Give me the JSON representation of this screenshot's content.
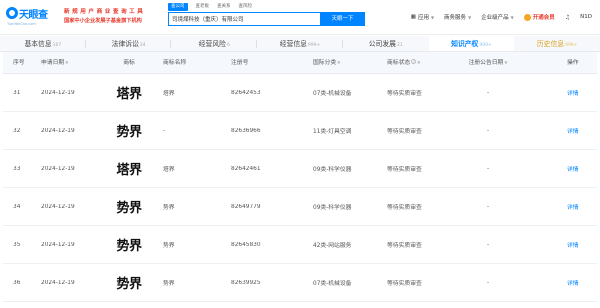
{
  "header": {
    "logo_text": "天眼查",
    "logo_sub": "TianYanCha.com",
    "promo_line1": "新 规 用 户 商 业 查 询 工 具",
    "promo_line2": "国家中小企业发展子基金旗下机构",
    "search_tabs": [
      "查公司",
      "查老板",
      "查关系",
      "查风险"
    ],
    "search_value": "司境煤科技（重庆）有限公司",
    "search_button": "天眼一下",
    "nav": {
      "app": "应用",
      "business_services": "商务服务",
      "enterprise_products": "企业级产品",
      "vip": "开通会员",
      "user": "N1D"
    }
  },
  "tabs": [
    {
      "label": "基本信息",
      "count": "167"
    },
    {
      "label": "法律诉讼",
      "count": "34"
    },
    {
      "label": "经营风险",
      "count": "6"
    },
    {
      "label": "经营信息",
      "count": "999+"
    },
    {
      "label": "公司发展",
      "count": "21"
    },
    {
      "label": "知识产权",
      "count": "999+"
    },
    {
      "label": "历史信息",
      "count": "999+"
    }
  ],
  "table": {
    "columns": [
      "序号",
      "申请日期",
      "商标",
      "商标名称",
      "注册号",
      "国际分类",
      "商标状态",
      "注册公告日期",
      "操作"
    ],
    "rows": [
      {
        "index": "31",
        "date": "2024-12-19",
        "mark": "塔界",
        "name": "塔界",
        "reg_no": "82642453",
        "class": "07类-机械设备",
        "status": "等待实质审查",
        "pub_date": "-",
        "op": "详情"
      },
      {
        "index": "32",
        "date": "2024-12-19",
        "mark": "势界",
        "name": "-",
        "reg_no": "82636966",
        "class": "11类-灯具空调",
        "status": "等待实质审查",
        "pub_date": "-",
        "op": "详情"
      },
      {
        "index": "33",
        "date": "2024-12-19",
        "mark": "塔界",
        "name": "塔界",
        "reg_no": "82642461",
        "class": "09类-科学仪器",
        "status": "等待实质审查",
        "pub_date": "-",
        "op": "详情"
      },
      {
        "index": "34",
        "date": "2024-12-19",
        "mark": "势界",
        "name": "势界",
        "reg_no": "82649779",
        "class": "09类-科学仪器",
        "status": "等待实质审查",
        "pub_date": "-",
        "op": "详情"
      },
      {
        "index": "35",
        "date": "2024-12-19",
        "mark": "势界",
        "name": "势界",
        "reg_no": "82645830",
        "class": "42类-网站服务",
        "status": "等待实质审查",
        "pub_date": "-",
        "op": "详情"
      },
      {
        "index": "36",
        "date": "2024-12-19",
        "mark": "势界",
        "name": "势界",
        "reg_no": "82639925",
        "class": "07类-机械设备",
        "status": "等待实质审查",
        "pub_date": "-",
        "op": "详情"
      }
    ]
  },
  "colors": {
    "brand": "#0084ff",
    "promo": "#e8392d",
    "history": "#d9a21e"
  }
}
